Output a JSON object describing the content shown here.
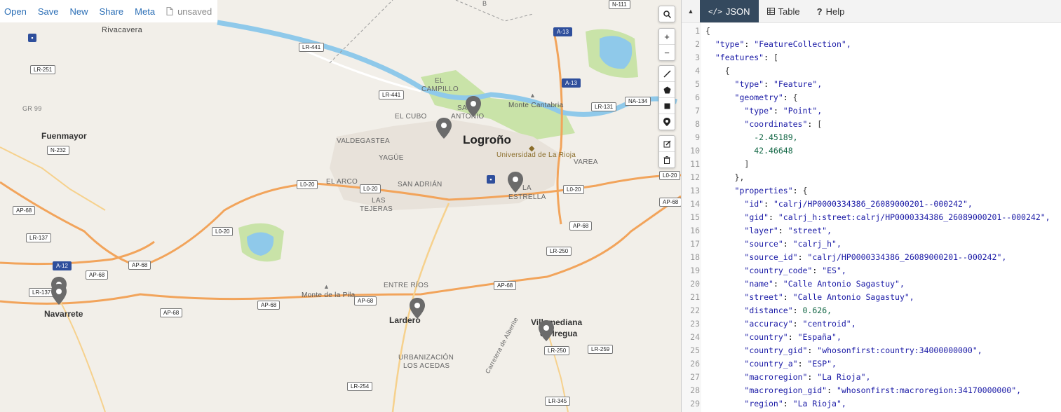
{
  "toolbar": {
    "open": "Open",
    "save": "Save",
    "new": "New",
    "share": "Share",
    "meta": "Meta",
    "unsaved": "unsaved"
  },
  "map": {
    "places": {
      "logrono": "Logroño",
      "fuenmayor": "Fuenmayor",
      "navarrete": "Navarrete",
      "lardero": "Lardero",
      "villamediana": "Villamediana",
      "de_iregua": "de Iregua",
      "rivacavera": "Rivacavera",
      "el_campillo_1": "EL",
      "el_campillo_2": "CAMPILLO",
      "san_antonio_1": "SAN",
      "san_antonio_2": "ANTONIO",
      "el_cubo": "EL CUBO",
      "monte_cantabria": "Monte Cantabria",
      "valdegastea": "VALDEGASTEA",
      "universidad": "Universidad de La Rioja",
      "yague": "YAGÜE",
      "varea": "VAREA",
      "el_arco": "EL ARCO",
      "san_adrian": "SAN ADRIÁN",
      "la_estrella_1": "LA",
      "la_estrella_2": "ESTRELLA",
      "las_tejeras_1": "LAS",
      "las_tejeras_2": "TEJERAS",
      "entre_rios": "ENTRE RÍOS",
      "monte_de_la_pila": "Monte de la Pila",
      "urb_1": "URBANIZACIÓN",
      "urb_2": "LOS ACEDAS",
      "carretera_alberite": "Carretera de Alberite",
      "gr99": "GR 99",
      "b": "B"
    },
    "roads": [
      "LR-441",
      "LR-251",
      "A-13",
      "A-13",
      "NA-134",
      "LR-441",
      "LR-131",
      "N-232",
      "L0-20",
      "L0-20",
      "L0-20",
      "L0-20",
      "AP-68",
      "AP-68",
      "LR-137",
      "L0-20",
      "AP-68",
      "A-12",
      "LR-250",
      "AP-68",
      "AP-68",
      "AP-68",
      "LR-137",
      "AP-68",
      "AP-68",
      "LR-250",
      "LR-259",
      "LR-254",
      "LR-345",
      "N-111"
    ],
    "controls": {
      "search": "search-icon",
      "zoom_in": "+",
      "zoom_out": "−"
    }
  },
  "panel": {
    "tabs": [
      {
        "label": "JSON",
        "icon": "code-icon",
        "active": true
      },
      {
        "label": "Table",
        "icon": "table-icon",
        "active": false
      },
      {
        "label": "Help",
        "icon": "question-icon",
        "active": false
      }
    ],
    "lines": [
      {
        "n": "1",
        "text": "{"
      },
      {
        "n": "2",
        "text": "  \"type\": \"FeatureCollection\","
      },
      {
        "n": "3",
        "text": "  \"features\": ["
      },
      {
        "n": "4",
        "text": "    {"
      },
      {
        "n": "5",
        "text": "      \"type\": \"Feature\","
      },
      {
        "n": "6",
        "text": "      \"geometry\": {"
      },
      {
        "n": "7",
        "text": "        \"type\": \"Point\","
      },
      {
        "n": "8",
        "text": "        \"coordinates\": ["
      },
      {
        "n": "9",
        "text": "          -2.45189,"
      },
      {
        "n": "10",
        "text": "          42.46648"
      },
      {
        "n": "11",
        "text": "        ]"
      },
      {
        "n": "12",
        "text": "      },"
      },
      {
        "n": "13",
        "text": "      \"properties\": {"
      },
      {
        "n": "14",
        "text": "        \"id\": \"calrj/HP0000334386_26089000201--000242\","
      },
      {
        "n": "15",
        "text": "        \"gid\": \"calrj_h:street:calrj/HP0000334386_26089000201--000242\","
      },
      {
        "n": "16",
        "text": "        \"layer\": \"street\","
      },
      {
        "n": "17",
        "text": "        \"source\": \"calrj_h\","
      },
      {
        "n": "18",
        "text": "        \"source_id\": \"calrj/HP0000334386_26089000201--000242\","
      },
      {
        "n": "19",
        "text": "        \"country_code\": \"ES\","
      },
      {
        "n": "20",
        "text": "        \"name\": \"Calle Antonio Sagastuy\","
      },
      {
        "n": "21",
        "text": "        \"street\": \"Calle Antonio Sagastuy\","
      },
      {
        "n": "22",
        "text": "        \"distance\": 0.626,"
      },
      {
        "n": "23",
        "text": "        \"accuracy\": \"centroid\","
      },
      {
        "n": "24",
        "text": "        \"country\": \"España\","
      },
      {
        "n": "25",
        "text": "        \"country_gid\": \"whosonfirst:country:34000000000\","
      },
      {
        "n": "26",
        "text": "        \"country_a\": \"ESP\","
      },
      {
        "n": "27",
        "text": "        \"macroregion\": \"La Rioja\","
      },
      {
        "n": "28",
        "text": "        \"macroregion_gid\": \"whosonfirst:macroregion:34170000000\","
      },
      {
        "n": "29",
        "text": "        \"region\": \"La Rioja\","
      }
    ]
  },
  "colors": {
    "accent": "#34495e",
    "link": "#2c6fb6",
    "motorway": "#f2a45b",
    "water": "#8fc9ea",
    "park": "#c9e3a8",
    "pin": "#6b6b6b"
  }
}
